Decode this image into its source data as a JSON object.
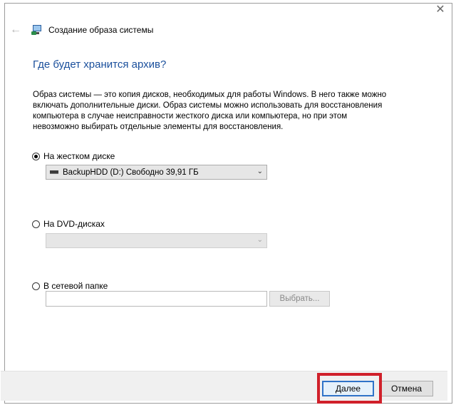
{
  "window": {
    "title": "Создание образа системы",
    "close_symbol": "✕",
    "back_symbol": "←"
  },
  "heading": "Где будет хранится архив?",
  "description": [
    "Образ системы — это копия дисков, необходимых для работы Windows. В него также можно",
    "включать дополнительные диски. Образ системы можно использовать для восстановления",
    "компьютера в случае неисправности жесткого диска или компьютера, но при этом",
    "невозможно выбирать отдельные элементы для восстановления."
  ],
  "options": {
    "hdd": {
      "label": "На жестком диске",
      "checked": true,
      "selected_value": "BackupHDD (D:)  Свободно 39,91 ГБ"
    },
    "dvd": {
      "label": "На DVD-дисках",
      "checked": false,
      "selected_value": ""
    },
    "network": {
      "label": "В сетевой папке",
      "checked": false,
      "path_value": "",
      "browse_label": "Выбрать..."
    }
  },
  "footer": {
    "next_label": "Далее",
    "cancel_label": "Отмена"
  },
  "colors": {
    "heading": "#1a4f9c",
    "highlight": "#d0202a",
    "default_button_border": "#2f73c8"
  }
}
